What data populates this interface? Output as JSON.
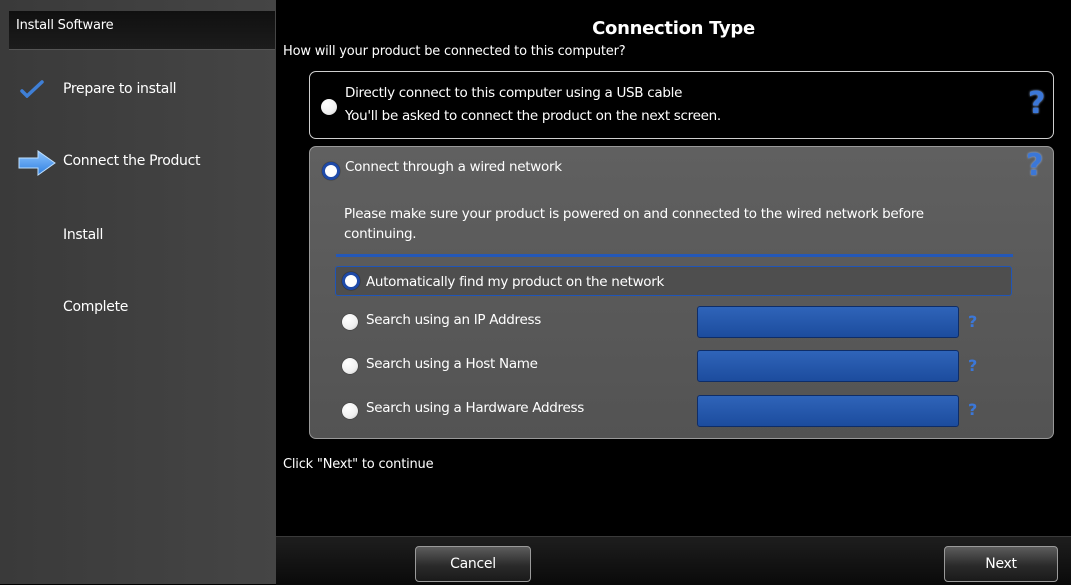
{
  "sidebar": {
    "header": "Install Software",
    "steps": [
      {
        "label": "Prepare to install",
        "icon": "checkmark-icon"
      },
      {
        "label": "Connect the Product",
        "icon": "arrow-right-icon"
      },
      {
        "label": "Install",
        "icon": ""
      },
      {
        "label": "Complete",
        "icon": ""
      }
    ]
  },
  "main": {
    "title": "Connection Type",
    "question": "How will your product be connected to this computer?",
    "usb": {
      "line1": "Directly connect to this computer using a USB cable",
      "line2": "You'll be asked to connect the product on the next screen."
    },
    "wired": {
      "label": "Connect through a wired network",
      "note_line1": "Please make sure your product is powered on and connected to the wired network before",
      "note_line2": "continuing.",
      "options": [
        {
          "label": "Automatically find my product on the network",
          "selected": true
        },
        {
          "label": "Search using an IP Address",
          "field_value": ""
        },
        {
          "label": "Search using a Host Name",
          "field_value": ""
        },
        {
          "label": "Search using a Hardware Address",
          "field_value": ""
        }
      ]
    },
    "continue_text": "Click \"Next\" to continue"
  },
  "help_symbol": "?",
  "footer": {
    "cancel_label": "Cancel",
    "next_label": "Next"
  },
  "colors": {
    "accent_blue": "#1f4aa8",
    "help_blue": "#3b77d8",
    "sidebar_bg": "#404040",
    "wired_panel_bg": "#5a5a5a"
  }
}
